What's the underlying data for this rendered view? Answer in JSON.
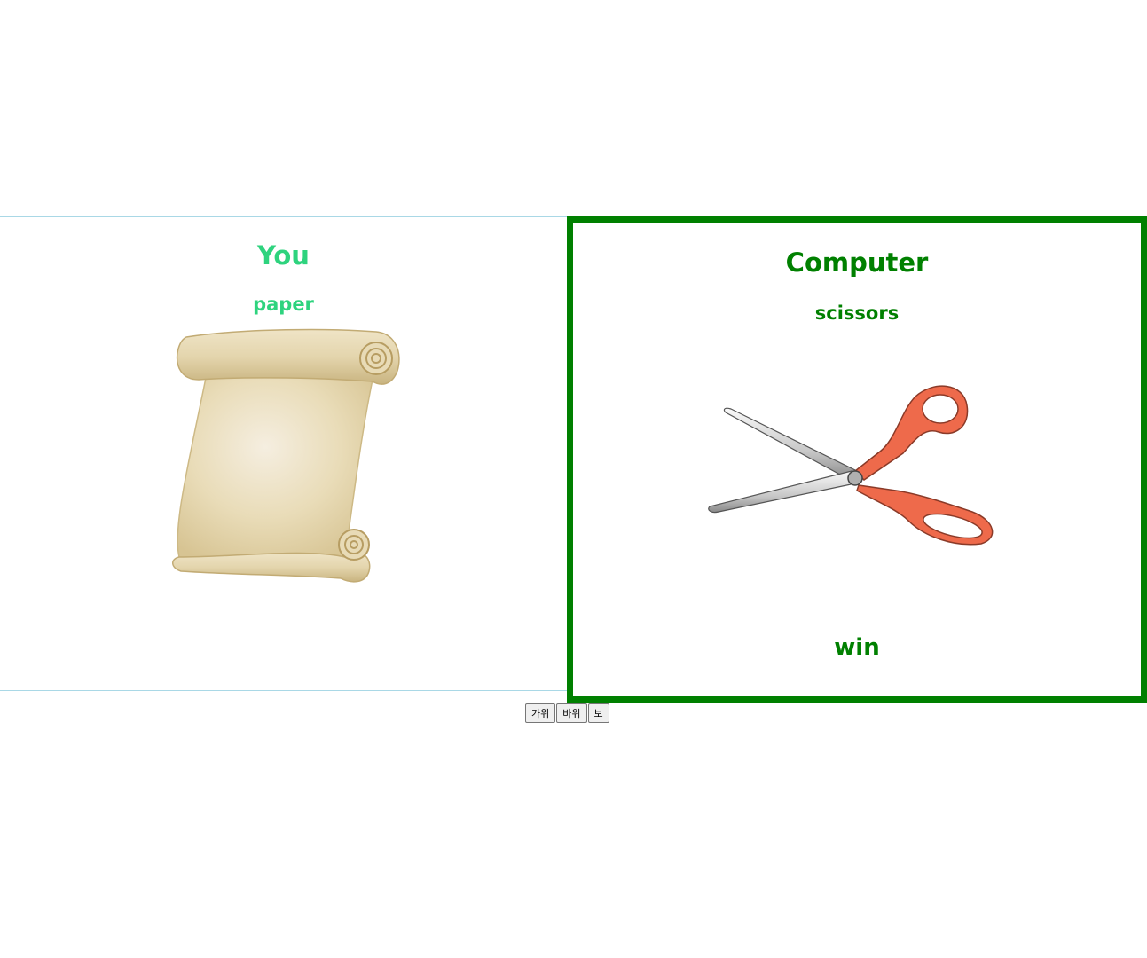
{
  "you": {
    "title": "You",
    "choice": "paper",
    "image_icon": "paper-scroll-icon",
    "title_color": "#2ed37e"
  },
  "computer": {
    "title": "Computer",
    "choice": "scissors",
    "image_icon": "scissors-icon",
    "result": "win",
    "border_color": "#008000",
    "text_color": "#008000"
  },
  "controls": {
    "scissors_label": "가위",
    "rock_label": "바위",
    "paper_label": "보"
  }
}
